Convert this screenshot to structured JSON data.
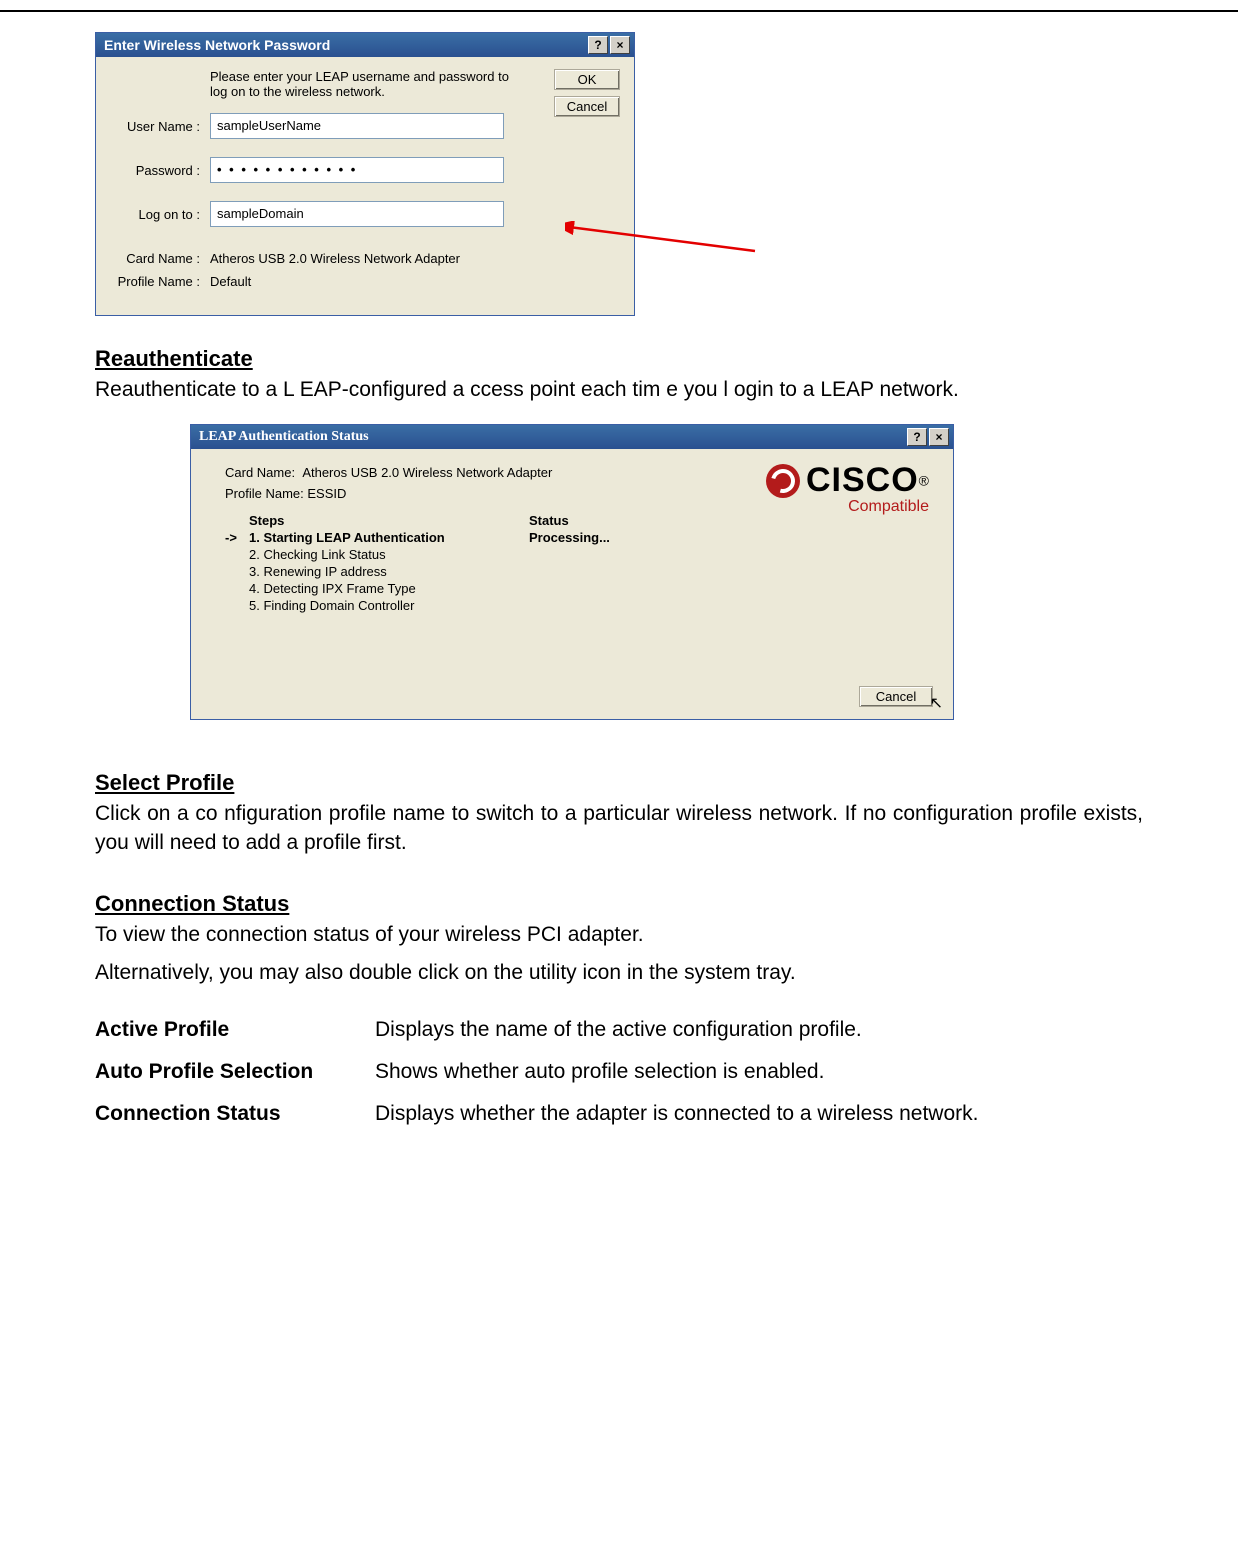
{
  "dialog1": {
    "title": "Enter Wireless Network Password",
    "instr": "Please enter your LEAP username and password to log on to the wireless network.",
    "labels": {
      "user": "User Name :",
      "pass": "Password :",
      "logon": "Log on to :",
      "card": "Card Name :",
      "profile": "Profile Name :"
    },
    "values": {
      "user": "sampleUserName",
      "pass": "• • • • • • • • • • • •",
      "logon": "sampleDomain",
      "card": "Atheros USB 2.0 Wireless Network Adapter",
      "profile": "Default"
    },
    "buttons": {
      "ok": "OK",
      "cancel": "Cancel"
    }
  },
  "sections": {
    "reauth_title": "Reauthenticate",
    "reauth_body": "Reauthenticate to a L EAP-configured a ccess point each tim e you l ogin to a LEAP network.",
    "select_title": "Select Profile",
    "select_body": "Click on a co nfiguration profile name to switch to a particular wireless network. If no configuration profile exists, you will need to add a profile first.",
    "conn_title": "Connection Status",
    "conn_body": "To view the connection status of your wireless PCI adapter.",
    "conn_body2": "Alternatively, you may also double click on the utility icon in the system tray."
  },
  "dialog2": {
    "title": "LEAP Authentication Status",
    "card_label": "Card Name:",
    "card_value": "Atheros USB 2.0 Wireless Network Adapter",
    "profile_label": "Profile Name:",
    "profile_value": "ESSID",
    "steps_hdr": "Steps",
    "status_hdr": "Status",
    "steps": [
      {
        "txt": "1. Starting LEAP Authentication",
        "bold": true,
        "arrow": true,
        "status": "Processing..."
      },
      {
        "txt": "2. Checking Link Status"
      },
      {
        "txt": "3. Renewing IP address"
      },
      {
        "txt": "4. Detecting IPX Frame Type"
      },
      {
        "txt": "5. Finding Domain Controller"
      }
    ],
    "cancel": "Cancel",
    "logo_text": "CISCO",
    "compat": "Compatible"
  },
  "defs": [
    {
      "term": "Active Profile",
      "desc": "Displays the name of the active configuration profile."
    },
    {
      "term": "Auto Profile Selection",
      "desc": "Shows whether auto profile selection is enabled."
    },
    {
      "term": "Connection Status",
      "desc": "Displays whether the adapter is connected to a wireless network."
    }
  ]
}
